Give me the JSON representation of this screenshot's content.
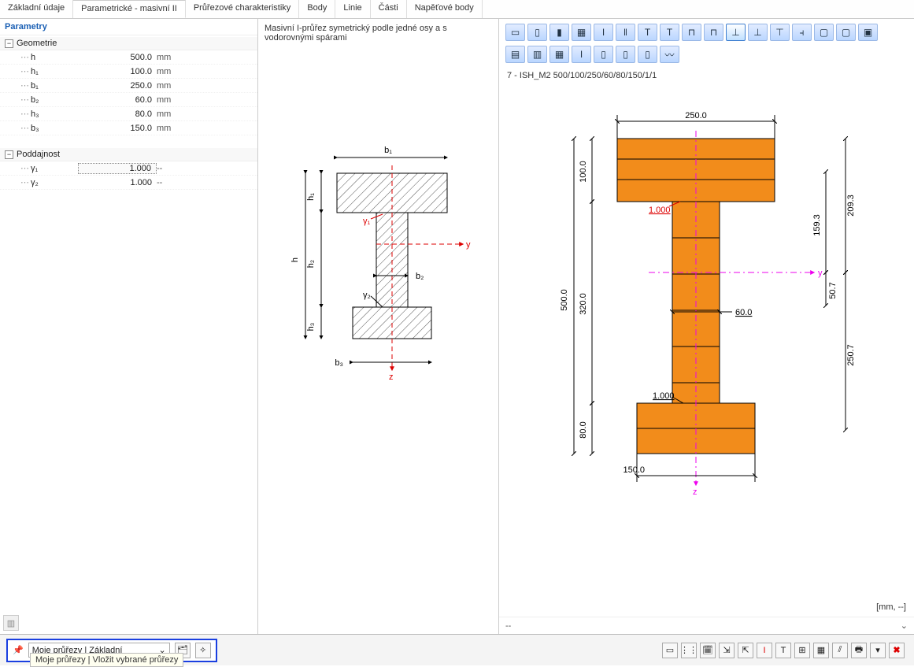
{
  "tabs": {
    "t0": "Základní údaje",
    "t1": "Parametrické - masivní II",
    "t2": "Průřezové charakteristiky",
    "t3": "Body",
    "t4": "Linie",
    "t5": "Části",
    "t6": "Napěťové body",
    "active": 1
  },
  "params_title": "Parametry",
  "groups": {
    "geom": {
      "label": "Geometrie",
      "rows": [
        {
          "n": "h",
          "v": "500.0",
          "u": "mm"
        },
        {
          "n": "h₁",
          "v": "100.0",
          "u": "mm"
        },
        {
          "n": "b₁",
          "v": "250.0",
          "u": "mm"
        },
        {
          "n": "b₂",
          "v": "60.0",
          "u": "mm"
        },
        {
          "n": "h₃",
          "v": "80.0",
          "u": "mm"
        },
        {
          "n": "b₃",
          "v": "150.0",
          "u": "mm"
        }
      ]
    },
    "podd": {
      "label": "Poddajnost",
      "rows": [
        {
          "n": "γ₁",
          "v": "1.000",
          "u": "--",
          "sel": true
        },
        {
          "n": "γ₂",
          "v": "1.000",
          "u": "--"
        }
      ]
    }
  },
  "mid_title": "Masivní I-průřez symetrický podle jedné osy a s vodorovnými spárami",
  "mid_diagram": {
    "labels": {
      "b1": "b₁",
      "h1": "h₁",
      "h": "h",
      "h2": "h₂",
      "h3": "h₃",
      "b2": "b₂",
      "b3": "b₃",
      "g1": "γ₁",
      "g2": "γ₂",
      "y": "y",
      "z": "z"
    }
  },
  "right_label": "7 - ISH_M2 500/100/250/60/80/150/1/1",
  "section_icons": [
    "rect",
    "rect-h",
    "rect-v",
    "grid",
    "I",
    "dbl",
    "T",
    "T2",
    "U",
    "Ur",
    "Trev",
    "Ts",
    "Tbox",
    "Tdbl",
    "O",
    "Or",
    "Of",
    "mb",
    "mb2",
    "mb3",
    "Ic",
    "Ib",
    "Ib2",
    "Ib3",
    "wv"
  ],
  "right_diagram": {
    "dims": {
      "top": "250.0",
      "bottom": "150.0",
      "left_h": "500.0",
      "left_h1": "100.0",
      "left_h2": "320.0",
      "left_h3": "80.0",
      "right_t": "209.3",
      "right_s1": "159.3",
      "right_s2": "50.7",
      "right_s3": "250.7",
      "web": "60.0"
    },
    "gamma1": "1.000",
    "gamma2": "1.000",
    "y": "y",
    "z": "z"
  },
  "units": "[mm, --]",
  "status_dash": "--",
  "footer": {
    "dropdown": "Moje průřezy | Základní",
    "hint": "Moje průřezy | Vložit vybrané průřezy",
    "pin": "📌"
  }
}
